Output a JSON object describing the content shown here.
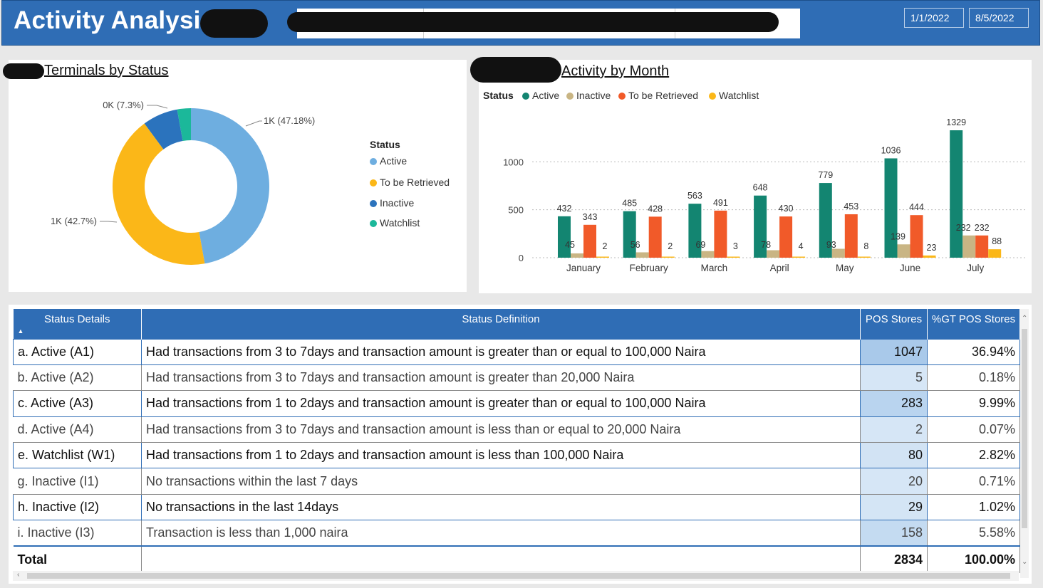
{
  "header": {
    "title": "Activity Analysis",
    "date_start": "1/1/2022",
    "date_end": "8/5/2022"
  },
  "donut": {
    "title": "Terminals by Status",
    "legend_title": "Status",
    "legend": [
      {
        "label": "Active",
        "color": "#6eaee0"
      },
      {
        "label": "To be Retrieved",
        "color": "#fbb718"
      },
      {
        "label": "Inactive",
        "color": "#2b73bd"
      },
      {
        "label": "Watchlist",
        "color": "#1bb89a"
      }
    ],
    "labels": {
      "active": "1K (47.18%)",
      "retrieved": "1K (42.7%)",
      "inactive": "0K (7.3%)"
    }
  },
  "bar": {
    "title": "Activity by Month",
    "legend_title": "Status",
    "legend": [
      {
        "label": "Active",
        "color": "#138571"
      },
      {
        "label": "Inactive",
        "color": "#c9b584"
      },
      {
        "label": "To be Retrieved",
        "color": "#f15a29"
      },
      {
        "label": "Watchlist",
        "color": "#fbb718"
      }
    ]
  },
  "chart_data": [
    {
      "type": "pie",
      "title": "Terminals by Status",
      "categories": [
        "Active",
        "To be Retrieved",
        "Inactive",
        "Watchlist"
      ],
      "values": [
        47.18,
        42.7,
        7.3,
        2.82
      ],
      "slice_labels": [
        "1K (47.18%)",
        "1K (42.7%)",
        "0K (7.3%)",
        ""
      ],
      "colors": [
        "#6eaee0",
        "#fbb718",
        "#2b73bd",
        "#1bb89a"
      ],
      "legend_placement": "right"
    },
    {
      "type": "bar",
      "title": "Activity by Month",
      "categories": [
        "January",
        "February",
        "March",
        "April",
        "May",
        "June",
        "July"
      ],
      "series": [
        {
          "name": "Active",
          "color": "#138571",
          "values": [
            432,
            485,
            563,
            648,
            779,
            1036,
            1329
          ]
        },
        {
          "name": "Inactive",
          "color": "#c9b584",
          "values": [
            45,
            56,
            69,
            78,
            93,
            139,
            232
          ]
        },
        {
          "name": "To be Retrieved",
          "color": "#f15a29",
          "values": [
            343,
            428,
            491,
            430,
            453,
            444,
            232
          ]
        },
        {
          "name": "Watchlist",
          "color": "#fbb718",
          "values": [
            2,
            2,
            3,
            4,
            8,
            23,
            88
          ]
        }
      ],
      "ylim": [
        0,
        1329
      ],
      "yticks": [
        0,
        500,
        1000
      ],
      "legend_placement": "top-left"
    }
  ],
  "table": {
    "headers": [
      "Status Details",
      "Status Definition",
      "POS Stores",
      "%GT POS Stores"
    ],
    "rows": [
      {
        "detail": "a. Active (A1)",
        "definition": "Had transactions from 3 to 7days and transaction amount is greater than or equal to 100,000 Naira",
        "pos": "1047",
        "pct": "36.94%",
        "shade": "#a9c9ea"
      },
      {
        "detail": "b. Active (A2)",
        "definition": "Had transactions from 3 to 7days and transaction amount is greater than 20,000 Naira",
        "pos": "5",
        "pct": "0.18%",
        "shade": "#d6e6f6"
      },
      {
        "detail": "c. Active (A3)",
        "definition": "Had transactions from 1 to 2days and transaction amount is greater than or equal to 100,000 Naira",
        "pos": "283",
        "pct": "9.99%",
        "shade": "#b9d4ef"
      },
      {
        "detail": "d. Active (A4)",
        "definition": "Had transactions from 3 to 7days and transaction amount is less than or equal to 20,000 Naira",
        "pos": "2",
        "pct": "0.07%",
        "shade": "#d6e6f6"
      },
      {
        "detail": "e. Watchlist (W1)",
        "definition": "Had transactions from 1 to 2days and transaction amount is less than 100,000 Naira",
        "pos": "80",
        "pct": "2.82%",
        "shade": "#d2e3f4"
      },
      {
        "detail": "g. Inactive (I1)",
        "definition": "No transactions within the last 7 days",
        "pos": "20",
        "pct": "0.71%",
        "shade": "#d6e6f6"
      },
      {
        "detail": "h. Inactive (I2)",
        "definition": "No transactions in the last 14days",
        "pos": "29",
        "pct": "1.02%",
        "shade": "#d4e5f5"
      },
      {
        "detail": "i. Inactive (I3)",
        "definition": "Transaction is less than 1,000 naira",
        "pos": "158",
        "pct": "5.58%",
        "shade": "#c4dbf1"
      }
    ],
    "selected_rows": [
      0,
      2,
      4,
      6
    ],
    "total": {
      "label": "Total",
      "pos": "2834",
      "pct": "100.00%"
    }
  }
}
